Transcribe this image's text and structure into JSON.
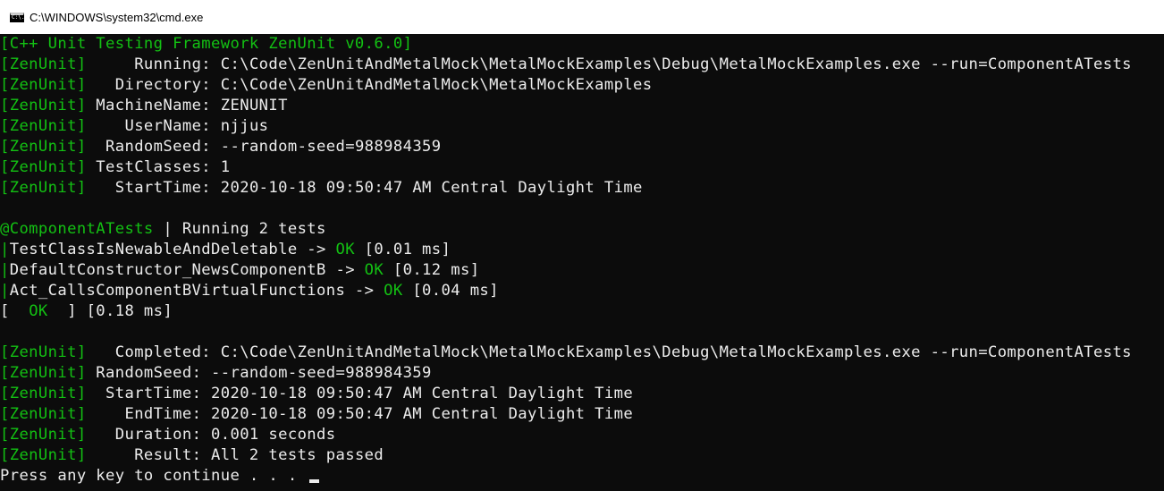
{
  "window": {
    "title": "C:\\WINDOWS\\system32\\cmd.exe",
    "icon": "cmd-app-icon",
    "icon_text": "C:\\."
  },
  "colors": {
    "background": "#0c0c0c",
    "text": "#cccccc",
    "accent_green": "#13c113"
  },
  "console": {
    "header": "[C++ Unit Testing Framework ZenUnit v0.6.0]",
    "tag": "[ZenUnit]",
    "info_lines": [
      {
        "key": "     Running:",
        "value": " C:\\Code\\ZenUnitAndMetalMock\\MetalMockExamples\\Debug\\MetalMockExamples.exe --run=ComponentATests"
      },
      {
        "key": "   Directory:",
        "value": " C:\\Code\\ZenUnitAndMetalMock\\MetalMockExamples"
      },
      {
        "key": " MachineName:",
        "value": " ZENUNIT"
      },
      {
        "key": "    UserName:",
        "value": " njjus"
      },
      {
        "key": "  RandomSeed:",
        "value": " --random-seed=988984359"
      },
      {
        "key": " TestClasses:",
        "value": " 1"
      },
      {
        "key": "   StartTime:",
        "value": " 2020-10-18 09:50:47 AM Central Daylight Time"
      }
    ],
    "class_name": "@ComponentATests",
    "class_sep": " | ",
    "class_summary": "Running 2 tests",
    "tests": [
      {
        "name": "TestClassIsNewableAndDeletable -> ",
        "status": "OK",
        "time": " [0.01 ms]"
      },
      {
        "name": "DefaultConstructor_NewsComponentB -> ",
        "status": "OK",
        "time": " [0.12 ms]"
      },
      {
        "name": "Act_CallsComponentBVirtualFunctions -> ",
        "status": "OK",
        "time": " [0.04 ms]"
      }
    ],
    "test_prefix": "|",
    "class_result": {
      "open": "[",
      "status": "  OK  ",
      "close": "] [0.18 ms]"
    },
    "summary_lines": [
      {
        "key": "   Completed:",
        "value": " C:\\Code\\ZenUnitAndMetalMock\\MetalMockExamples\\Debug\\MetalMockExamples.exe --run=ComponentATests"
      },
      {
        "key": " RandomSeed:",
        "value": " --random-seed=988984359"
      },
      {
        "key": "  StartTime:",
        "value": " 2020-10-18 09:50:47 AM Central Daylight Time"
      },
      {
        "key": "    EndTime:",
        "value": " 2020-10-18 09:50:47 AM Central Daylight Time"
      },
      {
        "key": "   Duration:",
        "value": " 0.001 seconds"
      },
      {
        "key": "     Result:",
        "value": " All 2 tests passed"
      }
    ],
    "prompt": "Press any key to continue . . . "
  }
}
